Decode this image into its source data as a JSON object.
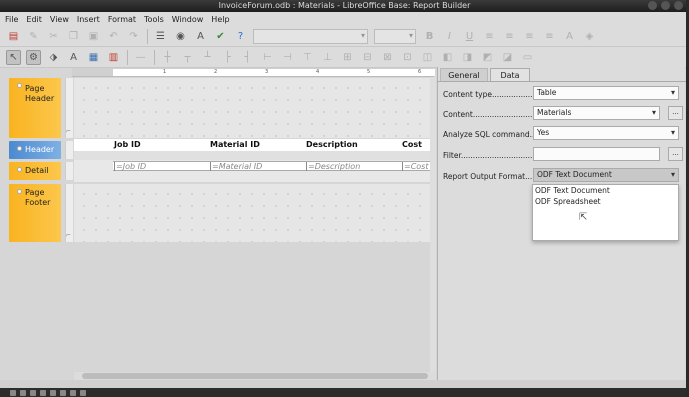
{
  "window": {
    "title": "InvoiceForum.odb : Materials - LibreOffice Base: Report Builder"
  },
  "menu": [
    "File",
    "Edit",
    "View",
    "Insert",
    "Format",
    "Tools",
    "Window",
    "Help"
  ],
  "toolbar1": {
    "font_name": "",
    "font_size": ""
  },
  "ruler": {
    "numbers": [
      "1",
      "2",
      "3",
      "4",
      "5",
      "6"
    ]
  },
  "sections": {
    "page_header": "Page Header",
    "header": "Header",
    "detail": "Detail",
    "page_footer": "Page Footer"
  },
  "report": {
    "headers": [
      "Job ID",
      "Material ID",
      "Description",
      "Cost"
    ],
    "details": [
      "=Job ID",
      "=Material ID",
      "=Description",
      "=Cost"
    ]
  },
  "panel": {
    "tabs": [
      "General",
      "Data"
    ],
    "active_tab": "Data",
    "content_type_label": "Content type......................",
    "content_type_value": "Table",
    "content_label": "Content.................................",
    "content_value": "Materials",
    "analyze_label": "Analyze SQL command...",
    "analyze_value": "Yes",
    "filter_label": "Filter......................................",
    "filter_value": "",
    "output_label": "Report Output Format...",
    "output_value": "ODF Text Document",
    "output_options": [
      "ODF Text Document",
      "ODF Spreadsheet"
    ],
    "more_button": "..."
  },
  "colors": {
    "section_orange": "#f9b320",
    "section_blue": "#4a8ad0",
    "titlebar": "#2a2a2a"
  }
}
